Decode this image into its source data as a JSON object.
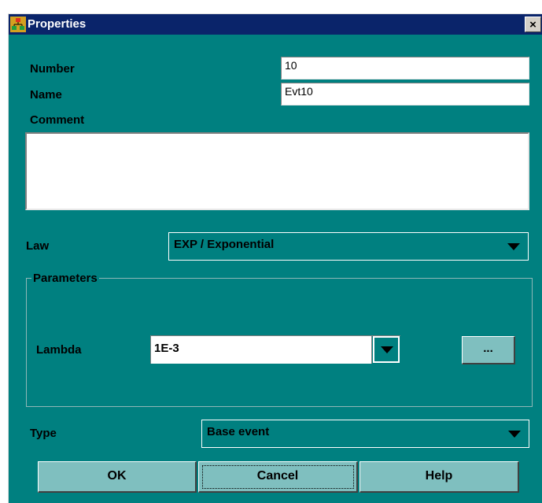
{
  "window": {
    "title": "Properties",
    "close_label": "×"
  },
  "form": {
    "number_label": "Number",
    "number_value": "10",
    "name_label": "Name",
    "name_value": "Evt10",
    "comment_label": "Comment",
    "comment_value": "",
    "law_label": "Law",
    "law_value": "EXP / Exponential",
    "parameters_label": "Parameters",
    "lambda_label": "Lambda",
    "lambda_value": "1E-3",
    "ellipsis_label": "...",
    "type_label": "Type",
    "type_value": "Base event"
  },
  "buttons": {
    "ok": "OK",
    "cancel": "Cancel",
    "help": "Help"
  },
  "colors": {
    "background": "#008080",
    "titlebar": "#0a246a",
    "button_face": "#7fbfbf"
  }
}
